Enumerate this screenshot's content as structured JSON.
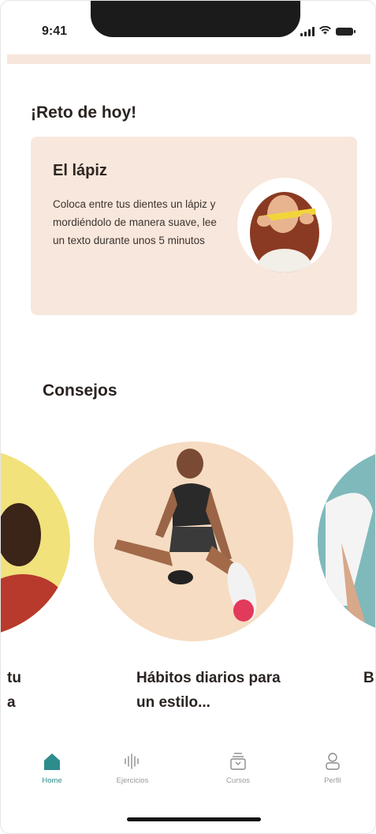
{
  "status_bar": {
    "time": "9:41"
  },
  "challenge": {
    "heading": "¡Reto de hoy!",
    "title": "El lápiz",
    "description": "Coloca entre tus dientes un lápiz y mordiéndolo de manera suave, lee un texto durante unos 5 minutos"
  },
  "tips": {
    "heading": "Consejos",
    "items": [
      {
        "label": "tu a"
      },
      {
        "label": "Hábitos diarios para un estilo..."
      },
      {
        "label": "B"
      }
    ]
  },
  "nav": {
    "items": [
      {
        "label": "Home",
        "icon": "home-icon",
        "active": true
      },
      {
        "label": "Ejercicios",
        "icon": "waveform-icon"
      },
      {
        "label": "Cursos",
        "icon": "course-box-icon"
      },
      {
        "label": "Perfil",
        "icon": "user-icon"
      }
    ]
  },
  "colors": {
    "accent": "#2d8c8c",
    "card_background": "#f8e7dc",
    "tip_left": "#f1e27c",
    "tip_center": "#f6dcc2",
    "tip_right": "#7fb9bb"
  }
}
